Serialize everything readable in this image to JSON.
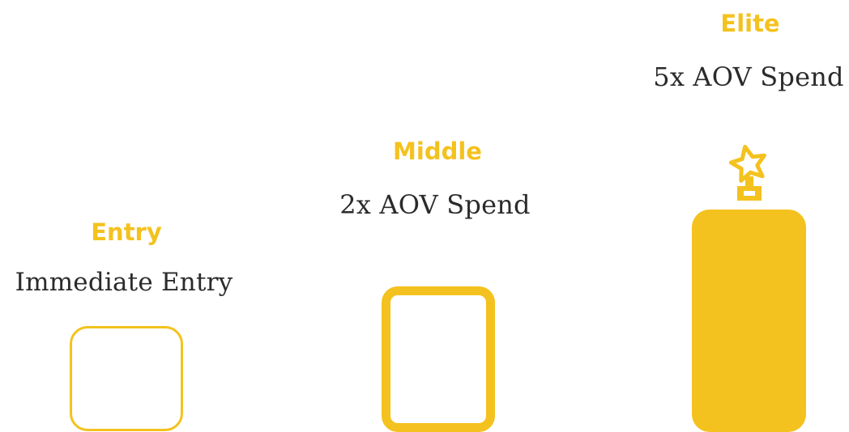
{
  "accent_color": "#F4C21E",
  "tiers": [
    {
      "name": "Entry",
      "requirement": "Immediate Entry",
      "style": "outline-thin"
    },
    {
      "name": "Middle",
      "requirement": "2x AOV Spend",
      "style": "outline-thick"
    },
    {
      "name": "Elite",
      "requirement": "5x AOV Spend",
      "style": "filled",
      "icon": "trophy-icon"
    }
  ]
}
